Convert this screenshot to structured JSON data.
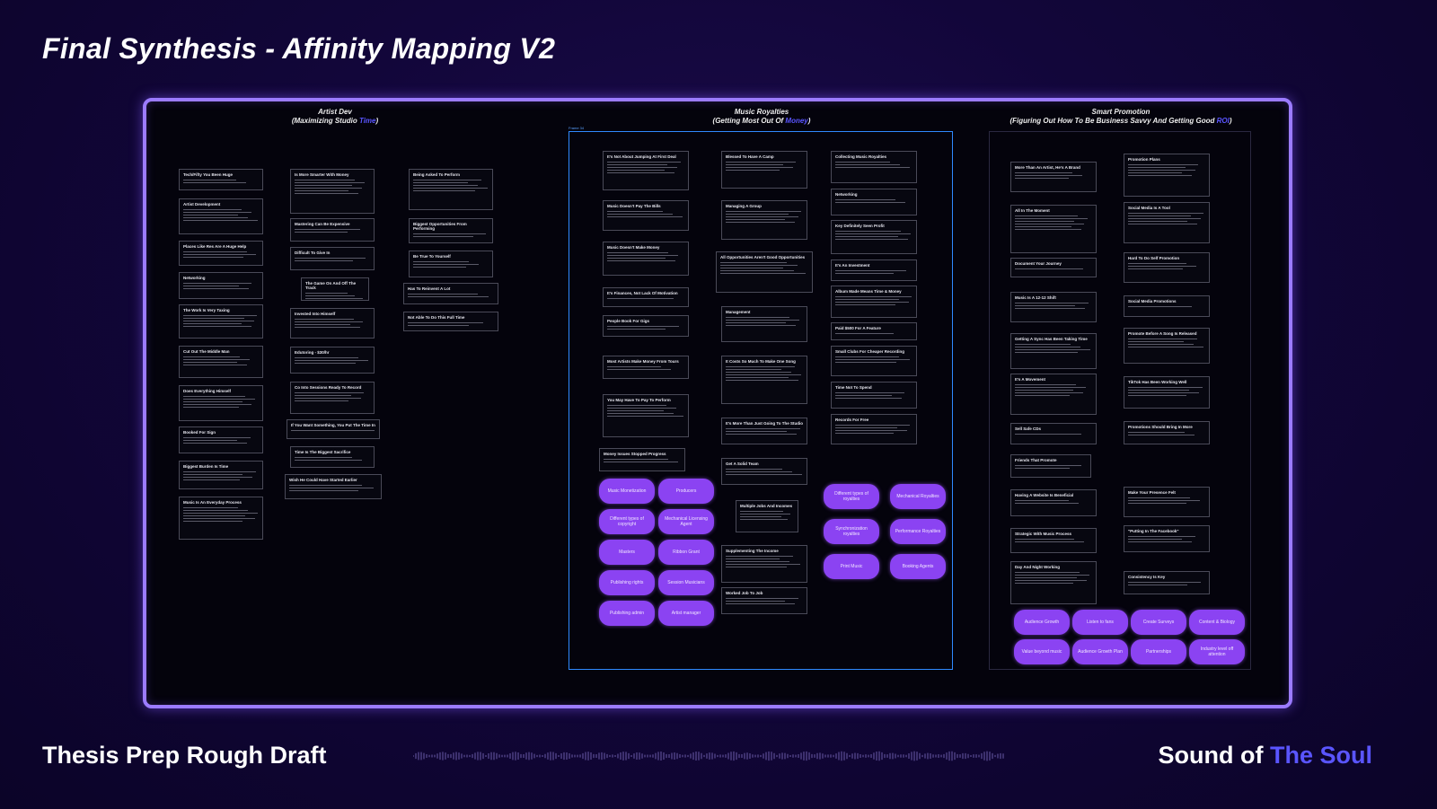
{
  "title": "Final Synthesis - Affinity Mapping V2",
  "footer": {
    "left": "Thesis Prep Rough Draft",
    "right_main": "Sound of ",
    "right_accent": "The Soul"
  },
  "colors": {
    "accent": "#5a55ff",
    "pill": "#8b43f2",
    "frame": "#9b7bff",
    "panel_border": "#2f89ff"
  },
  "columns": {
    "artist": {
      "line1": "Artist Dev",
      "line2_a": "(Maximizing Studio ",
      "line2_accent": "Time",
      "line2_b": ")"
    },
    "music": {
      "line1": "Music Royalties",
      "line2_a": "(Getting Most Out Of ",
      "line2_accent": "Money",
      "line2_b": ")",
      "panel_label": "Frame 34"
    },
    "smart": {
      "line1": "Smart Promotion",
      "line2_a": "(Figuring Out How To Be Business Savvy And Getting Good ",
      "line2_accent": "ROI",
      "line2_b": ")"
    }
  },
  "notes": [
    "Tech/Fifty You Been Huge",
    "Artist Development",
    "Places Like Res Are A Huge Help",
    "Networking",
    "The Work Is Very Taxing",
    "Cut Out The Middle Man",
    "Does Everything Himself",
    "Booked For Sign",
    "Biggest Burden Is Time",
    "Music Is An Everyday Process",
    "Is More Smarter With Money",
    "Mastering Can Be Expensive",
    "Difficult To Give In",
    "The Game On And Off The Track",
    "Invested Into Himself",
    "Edutoring - $30/hr",
    "Co Into Sessions Ready To Record",
    "If You Want Something, You Put The Time In",
    "Time Is The Biggest Sacrifice",
    "Wish He Could Have Started Earlier",
    "Being Asked To Perform",
    "Biggest Opportunities From Performing",
    "Be True To Yourself",
    "Has To Reinvent A Lot",
    "Not Able To Do This Full Time",
    "It's Not About Jumping At First Deal",
    "Music Doesn't Pay The Bills",
    "Music Doesn't Make Money",
    "It's Finances, Not Lack Of Motivation",
    "People Book For Gigs",
    "Most Artists Make Money From Tours",
    "You May Have To Pay To Perform",
    "Money Issues Stopped Progress",
    "Blessed To Have A Camp",
    "Managing A Group",
    "All Opportunities Aren't Good Opportunities",
    "Management",
    "It Costs So Much To Make One Song",
    "It's More Than Just Going To The Studio",
    "Get A Solid Team",
    "Multiple Jobs And Incomes",
    "Supplementing The Income",
    "Worked Job To Job",
    "Collecting Music Royalties",
    "Networking",
    "Key Definitely Seen Profit",
    "It's An Investment",
    "Album Made Means Time & Money",
    "Paid $500 For A Feature",
    "Small Clubs For Cheaper Recording",
    "Time Not To Spend",
    "Records For Free",
    "More Than An Artist, He's A Brand",
    "All In The Moment",
    "Document Your Journey",
    "Music Is A 12-12 Shift",
    "Getting A Sync Has Been Taking Time",
    "It's A Movement",
    "Sell Safe CDs",
    "Friends That Promote",
    "Having A Website Is Beneficial",
    "Strategic With Music Process",
    "Day And Night Working",
    "Promotion Plans",
    "Social Media Is A Tool",
    "Hard To Do Self Promotion",
    "Social Media Promotions",
    "Promote Before A Song Is Released",
    "TikTok Has Been Working Well",
    "Promotions Should Bring In More",
    "Make Your Presence Felt",
    "\"Putting In The Facebook\"",
    "Consistency Is Key"
  ],
  "pills": {
    "music_left": [
      "Music Monetization",
      "Producers",
      "Different types of copyright",
      "Mechanical Licensing Agent",
      "Masters",
      "Ribbon Grant",
      "Publishing rights",
      "Session Musicians",
      "Publishing admin",
      "Artist manager"
    ],
    "music_right": [
      "Different types of royalties",
      "Mechanical Royalties",
      "Synchronization royalties",
      "Performance Royalties",
      "Print Music",
      "Booking Agents"
    ],
    "smart": [
      "Audience Growth",
      "Listen to fans",
      "Create Surveys",
      "Content & Biology",
      "Value beyond music",
      "Audience Growth Plan",
      "Partnerships",
      "Industry level off attention"
    ]
  }
}
